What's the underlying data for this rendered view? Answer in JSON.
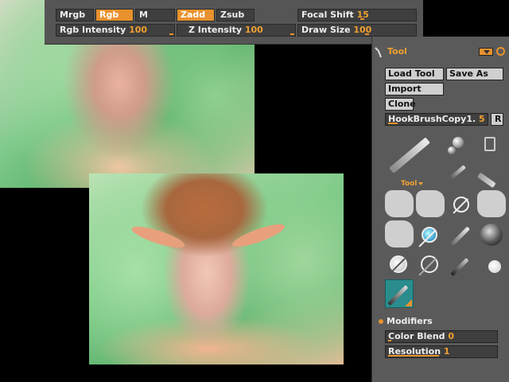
{
  "toolbar": {
    "mrgb": "Mrgb",
    "rgb": "Rgb",
    "m": "M",
    "zadd": "Zadd",
    "zsub": "Zsub",
    "focal_shift_label": "Focal Shift",
    "focal_shift_value": "15",
    "rgb_intensity_label": "Rgb Intensity",
    "rgb_intensity_value": "100",
    "z_intensity_label": "Z Intensity",
    "z_intensity_value": "100",
    "draw_size_label": "Draw Size",
    "draw_size_value": "100"
  },
  "tool_panel": {
    "title": "Tool",
    "load_tool": "Load Tool",
    "save_as": "Save As",
    "import": "Import",
    "clone": "Clone",
    "current_tool_name": "HookBrushCopy1.",
    "current_tool_value": "5",
    "r_button": "R",
    "tool_dropdown": "Tool",
    "modifiers": "Modifiers",
    "color_blend_label": "Color Blend",
    "color_blend_value": "0",
    "resolution_label": "Resolution",
    "resolution_value": "1"
  },
  "colors": {
    "accent": "#e8922e",
    "panel": "#5a5a5a",
    "field": "#3f3f3f"
  }
}
